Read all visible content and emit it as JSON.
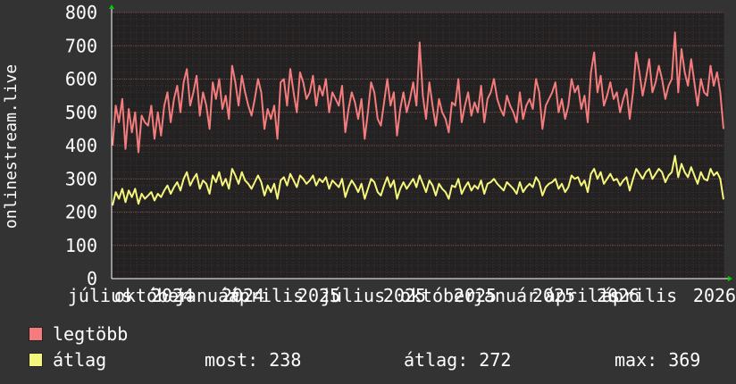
{
  "chart_data": {
    "type": "line",
    "ylabel": "onlinestream.live",
    "ylim": [
      0,
      800
    ],
    "y_ticks": [
      "0",
      "100",
      "200",
      "300",
      "400",
      "500",
      "600",
      "700",
      "800"
    ],
    "x_tick_labels": [
      "július",
      "október",
      "2024",
      "január",
      "2024",
      "április",
      "2025",
      "július",
      "2025",
      "október",
      "2025",
      "január",
      "2025",
      "április",
      "2026",
      "április",
      "2026"
    ],
    "grid": true,
    "legend_position": "bottom-left",
    "colors": {
      "background": "#333333",
      "plot": "#222222",
      "grid": "#5a3a3a",
      "max": "#f47c7c",
      "avg": "#f6f67c",
      "axis": "#ffffff"
    },
    "series": [
      {
        "name": "legtöbb",
        "color": "#f47c7c",
        "values": [
          400,
          520,
          470,
          540,
          390,
          510,
          440,
          500,
          380,
          490,
          470,
          460,
          520,
          420,
          500,
          430,
          520,
          560,
          470,
          540,
          580,
          500,
          590,
          630,
          520,
          560,
          610,
          490,
          560,
          520,
          450,
          590,
          540,
          600,
          510,
          550,
          480,
          640,
          590,
          520,
          610,
          560,
          520,
          490,
          540,
          600,
          560,
          450,
          510,
          480,
          520,
          420,
          590,
          600,
          520,
          630,
          560,
          500,
          620,
          590,
          540,
          560,
          610,
          520,
          580,
          550,
          600,
          500,
          560,
          540,
          520,
          580,
          440,
          510,
          560,
          530,
          480,
          540,
          420,
          500,
          590,
          560,
          480,
          460,
          530,
          600,
          520,
          560,
          430,
          510,
          560,
          500,
          540,
          590,
          520,
          710,
          550,
          480,
          590,
          520,
          460,
          540,
          500,
          480,
          440,
          530,
          520,
          600,
          470,
          520,
          560,
          490,
          530,
          500,
          580,
          470,
          540,
          560,
          600,
          540,
          510,
          490,
          550,
          520,
          500,
          470,
          560,
          480,
          520,
          540,
          510,
          600,
          560,
          450,
          520,
          540,
          560,
          590,
          500,
          540,
          480,
          520,
          600,
          560,
          580,
          510,
          550,
          470,
          620,
          680,
          560,
          610,
          520,
          550,
          590,
          540,
          560,
          500,
          540,
          570,
          480,
          560,
          680,
          620,
          550,
          600,
          660,
          560,
          590,
          640,
          600,
          540,
          580,
          600,
          740,
          560,
          690,
          620,
          580,
          660,
          590,
          520,
          600,
          560,
          550,
          640,
          580,
          620,
          560,
          450
        ],
        "mark_labels": [
          "legtöbb-line"
        ]
      },
      {
        "name": "átlag",
        "color": "#f6f67c",
        "values": [
          220,
          260,
          240,
          270,
          230,
          265,
          245,
          270,
          225,
          255,
          240,
          250,
          260,
          235,
          255,
          245,
          265,
          280,
          255,
          275,
          290,
          265,
          300,
          320,
          280,
          300,
          315,
          270,
          295,
          285,
          255,
          310,
          290,
          320,
          280,
          300,
          270,
          330,
          310,
          285,
          320,
          295,
          285,
          270,
          290,
          310,
          290,
          250,
          280,
          260,
          285,
          240,
          295,
          305,
          280,
          315,
          295,
          275,
          310,
          300,
          285,
          295,
          310,
          280,
          300,
          290,
          305,
          270,
          295,
          285,
          275,
          300,
          245,
          275,
          295,
          280,
          260,
          285,
          240,
          270,
          300,
          290,
          260,
          250,
          280,
          305,
          275,
          295,
          240,
          270,
          290,
          270,
          285,
          300,
          275,
          310,
          285,
          260,
          295,
          280,
          250,
          285,
          270,
          260,
          240,
          280,
          275,
          300,
          255,
          275,
          290,
          265,
          280,
          270,
          295,
          255,
          285,
          290,
          300,
          285,
          275,
          265,
          290,
          280,
          270,
          255,
          290,
          260,
          275,
          285,
          275,
          305,
          290,
          250,
          275,
          285,
          290,
          300,
          270,
          285,
          260,
          275,
          310,
          300,
          305,
          280,
          295,
          260,
          315,
          330,
          300,
          320,
          285,
          300,
          315,
          295,
          300,
          280,
          295,
          305,
          265,
          300,
          330,
          315,
          300,
          320,
          330,
          300,
          315,
          330,
          320,
          290,
          310,
          320,
          369,
          305,
          345,
          320,
          305,
          335,
          310,
          285,
          320,
          300,
          295,
          330,
          310,
          320,
          300,
          238
        ]
      }
    ],
    "stats": {
      "most_label": "most:",
      "most_value": "238",
      "atlag_label": "átlag:",
      "atlag_value": "272",
      "max_label": "max:",
      "max_value": "369"
    }
  },
  "legend": {
    "max_label": "legtöbb",
    "avg_label": "átlag"
  }
}
